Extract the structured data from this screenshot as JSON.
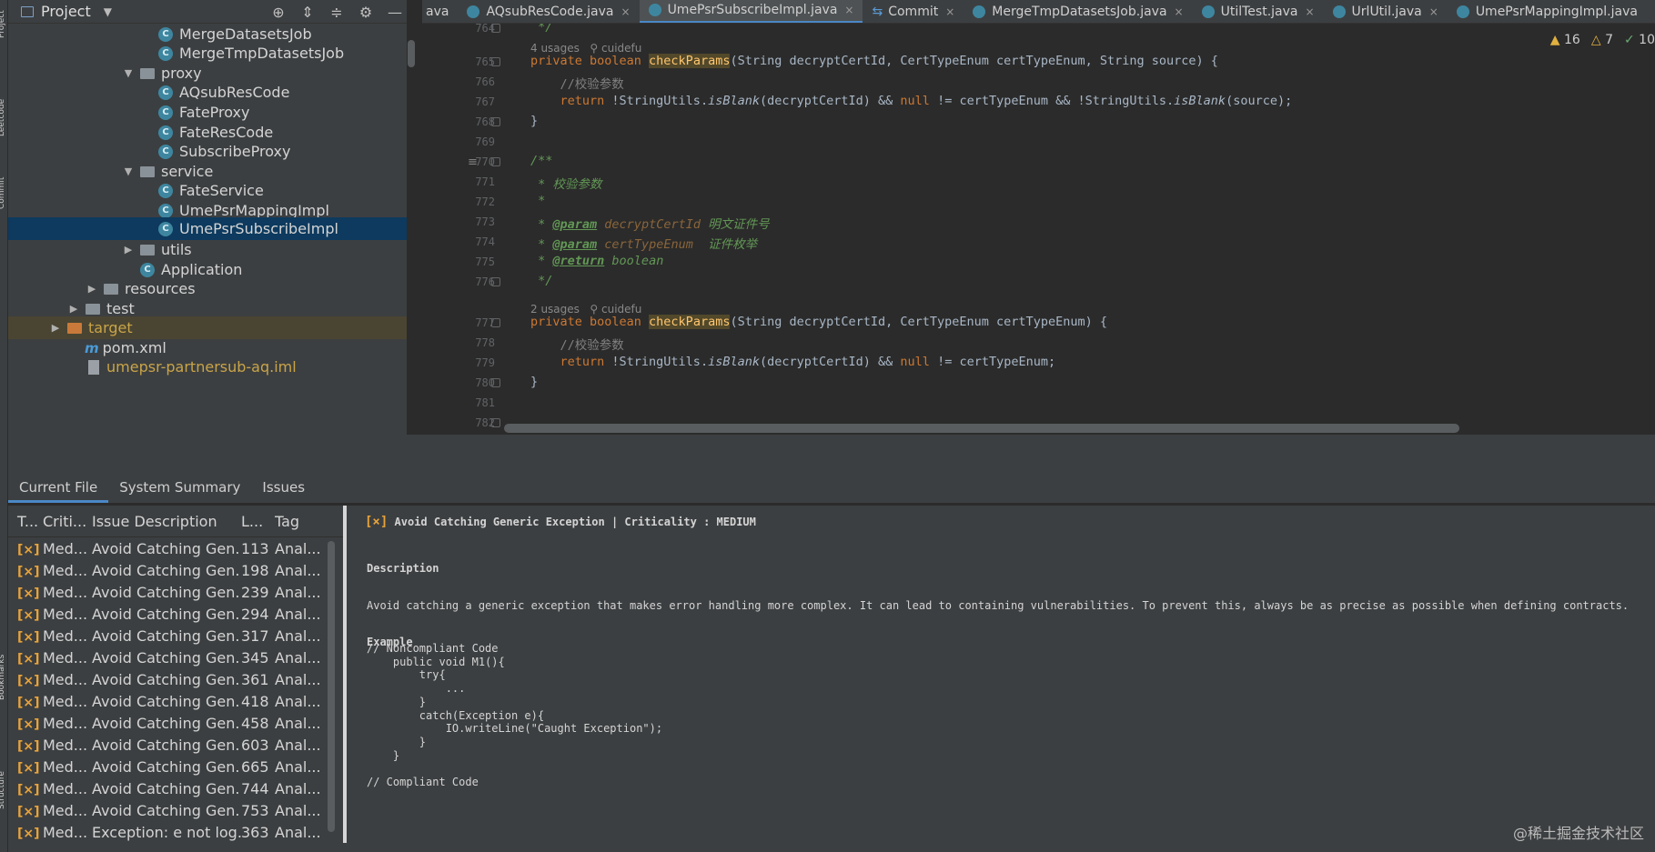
{
  "left_strip": {
    "labels": [
      "Project",
      "Leetcode",
      "Commit",
      "Bookmarks",
      "Structure"
    ]
  },
  "project": {
    "title": "Project",
    "items": [
      {
        "label": "MergeDatasetsJob",
        "kind": "class"
      },
      {
        "label": "MergeTmpDatasetsJob",
        "kind": "class"
      },
      {
        "label": "proxy",
        "kind": "folder",
        "expanded": true
      },
      {
        "label": "AQsubResCode",
        "kind": "class"
      },
      {
        "label": "FateProxy",
        "kind": "class"
      },
      {
        "label": "FateResCode",
        "kind": "class"
      },
      {
        "label": "SubscribeProxy",
        "kind": "class"
      },
      {
        "label": "service",
        "kind": "folder",
        "expanded": true
      },
      {
        "label": "FateService",
        "kind": "class"
      },
      {
        "label": "UmePsrMappingImpl",
        "kind": "class"
      },
      {
        "label": "UmePsrSubscribeImpl",
        "kind": "class",
        "selected": true
      },
      {
        "label": "utils",
        "kind": "folder",
        "expanded": false
      },
      {
        "label": "Application",
        "kind": "class"
      },
      {
        "label": "resources",
        "kind": "folder",
        "expanded": false
      },
      {
        "label": "test",
        "kind": "folder",
        "expanded": false
      },
      {
        "label": "target",
        "kind": "folder",
        "expanded": false
      },
      {
        "label": "pom.xml",
        "kind": "maven"
      },
      {
        "label": "umepsr-partnersub-aq.iml",
        "kind": "file"
      }
    ]
  },
  "editor": {
    "tabs": [
      {
        "label": "ava"
      },
      {
        "label": "AQsubResCode.java"
      },
      {
        "label": "UmePsrSubscribeImpl.java",
        "active": true
      },
      {
        "label": "Commit"
      },
      {
        "label": "MergeTmpDatasetsJob.java"
      },
      {
        "label": "UtilTest.java"
      },
      {
        "label": "UrlUtil.java"
      },
      {
        "label": "UmePsrMappingImpl.java"
      }
    ],
    "close_glyph": "×",
    "inspections": {
      "warnings": "16",
      "weak_warnings": "7",
      "ok": "10"
    },
    "usages_1": "4 usages",
    "author_1": "cuidefu",
    "usages_2": "2 usages",
    "author_2": "cuidefu",
    "line_numbers": [
      "764",
      "765",
      "766",
      "767",
      "768",
      "769",
      "770",
      "771",
      "772",
      "773",
      "774",
      "775",
      "776",
      "777",
      "778",
      "779",
      "780",
      "781",
      "782"
    ],
    "code": {
      "l764": " */",
      "l765_kw": "private boolean ",
      "l765_fn": "checkParams",
      "l765_rest": "(String decryptCertId, CertTypeEnum certTypeEnum, String source) {",
      "l766": "    //校验参数",
      "l767_kw": "    return ",
      "l767_a": "!StringUtils.",
      "l767_b": "isBlank",
      "l767_c": "(decryptCertId) && ",
      "l767_null": "null",
      "l767_d": " != certTypeEnum && !StringUtils.",
      "l767_e": "isBlank",
      "l767_f": "(source);",
      "l768": "}",
      "l770": "/**",
      "l771": " * 校验参数",
      "l772": " *",
      "l773_star": " * ",
      "l773_tag": "@param",
      "l773_par": " decryptCertId",
      "l773_txt": " 明文证件号",
      "l774_star": " * ",
      "l774_tag": "@param",
      "l774_par": " certTypeEnum",
      "l774_txt": "  证件枚举",
      "l775_star": " * ",
      "l775_tag": "@return",
      "l775_txt": " boolean",
      "l776": " */",
      "l777_kw": "private boolean ",
      "l777_fn": "checkParams",
      "l777_rest": "(String decryptCertId, CertTypeEnum certTypeEnum) {",
      "l778": "    //校验参数",
      "l779_kw": "    return ",
      "l779_a": "!StringUtils.",
      "l779_b": "isBlank",
      "l779_c": "(decryptCertId) && ",
      "l779_null": "null",
      "l779_d": " != certTypeEnum;",
      "l780": "}"
    }
  },
  "bottom": {
    "tabs": [
      {
        "label": "Current File",
        "active": true
      },
      {
        "label": "System Summary"
      },
      {
        "label": "Issues"
      }
    ],
    "table": {
      "headers": [
        "T...",
        "Criti...",
        "Issue Description",
        "L...",
        "Tag"
      ],
      "rows": [
        {
          "crit": "Med...",
          "desc": "Avoid Catching Gen...",
          "line": "113",
          "tag": "Anal..."
        },
        {
          "crit": "Med...",
          "desc": "Avoid Catching Gen...",
          "line": "198",
          "tag": "Anal..."
        },
        {
          "crit": "Med...",
          "desc": "Avoid Catching Gen...",
          "line": "239",
          "tag": "Anal..."
        },
        {
          "crit": "Med...",
          "desc": "Avoid Catching Gen...",
          "line": "294",
          "tag": "Anal..."
        },
        {
          "crit": "Med...",
          "desc": "Avoid Catching Gen...",
          "line": "317",
          "tag": "Anal..."
        },
        {
          "crit": "Med...",
          "desc": "Avoid Catching Gen...",
          "line": "345",
          "tag": "Anal..."
        },
        {
          "crit": "Med...",
          "desc": "Avoid Catching Gen...",
          "line": "361",
          "tag": "Anal..."
        },
        {
          "crit": "Med...",
          "desc": "Avoid Catching Gen...",
          "line": "418",
          "tag": "Anal..."
        },
        {
          "crit": "Med...",
          "desc": "Avoid Catching Gen...",
          "line": "458",
          "tag": "Anal..."
        },
        {
          "crit": "Med...",
          "desc": "Avoid Catching Gen...",
          "line": "603",
          "tag": "Anal..."
        },
        {
          "crit": "Med...",
          "desc": "Avoid Catching Gen...",
          "line": "665",
          "tag": "Anal..."
        },
        {
          "crit": "Med...",
          "desc": "Avoid Catching Gen...",
          "line": "744",
          "tag": "Anal..."
        },
        {
          "crit": "Med...",
          "desc": "Avoid Catching Gen...",
          "line": "753",
          "tag": "Anal..."
        },
        {
          "crit": "Med...",
          "desc": "Exception: e not log...",
          "line": "363",
          "tag": "Anal..."
        }
      ]
    },
    "detail": {
      "title": "Avoid Catching Generic Exception |  Criticality : MEDIUM",
      "description_label": "Description",
      "description": "Avoid catching a generic exception that makes error handling more complex. It can lead to containing vulnerabilities. To prevent this, always be as precise as possible when defining contracts.",
      "example_label": "Example",
      "code_lines": [
        "// Noncompliant Code",
        "    public void M1(){",
        "        try{",
        "            ...",
        "        }",
        "        catch(Exception e){",
        "            IO.writeLine(\"Caught Exception\");",
        "        }",
        "    }",
        "",
        "// Compliant Code"
      ]
    },
    "watermark": "@稀土掘金技术社区"
  },
  "colors": {
    "panel": "#3c3f41",
    "editor": "#2b2b2b",
    "selection": "#0d3a5e",
    "accent": "#4a88c7"
  }
}
